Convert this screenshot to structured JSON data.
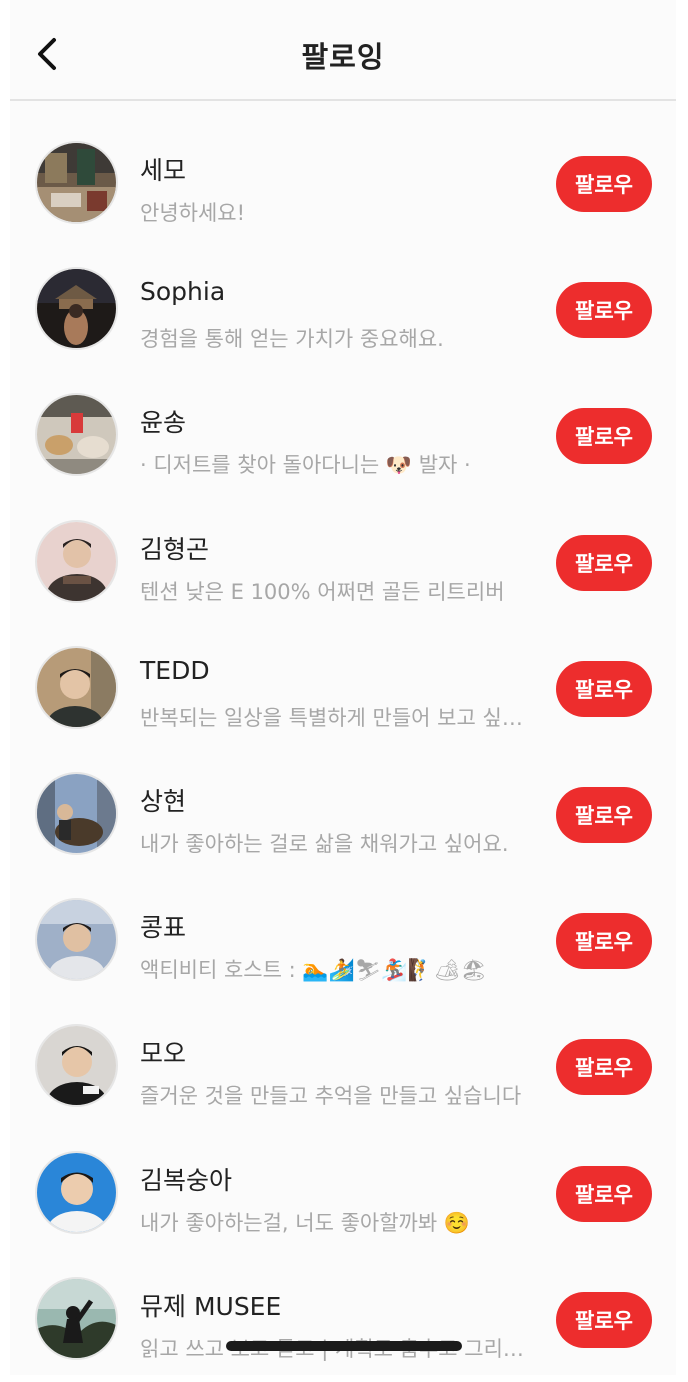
{
  "header": {
    "title": "팔로잉",
    "back_icon": "chevron-left-icon"
  },
  "colors": {
    "accent": "#ed2d2d",
    "secondary_text": "#a7a7a7",
    "primary_text": "#222222"
  },
  "users": [
    {
      "name": "세모",
      "bio": "안녕하세요!",
      "button": "팔로우"
    },
    {
      "name": "Sophia",
      "bio": "경험을 통해 얻는 가치가 중요해요.",
      "button": "팔로우"
    },
    {
      "name": "윤송",
      "bio": "· 디저트를 찾아 돌아다니는 🐶 발자 ·",
      "button": "팔로우"
    },
    {
      "name": "김형곤",
      "bio": "텐션 낮은 E 100% 어쩌면 골든 리트리버",
      "button": "팔로우"
    },
    {
      "name": "TEDD",
      "bio": "반복되는 일상을 특별하게 만들어 보고 싶…",
      "button": "팔로우"
    },
    {
      "name": "상현",
      "bio": "내가 좋아하는 걸로 삶을 채워가고 싶어요.",
      "button": "팔로우"
    },
    {
      "name": "콩표",
      "bio": "액티비티 호스트 : 🏊🏄⛷🏂🧗🏕🏖",
      "button": "팔로우"
    },
    {
      "name": "모오",
      "bio": "즐거운 것을 만들고 추억을 만들고 싶습니다",
      "button": "팔로우"
    },
    {
      "name": "김복숭아",
      "bio": "내가 좋아하는걸, 너도 좋아할까봐 ☺️",
      "button": "팔로우"
    },
    {
      "name": "뮤제 MUSEE",
      "bio": "읽고 쓰고 보고 듣고 | 계획로 춤추고 그리…",
      "button": "팔로우"
    }
  ]
}
